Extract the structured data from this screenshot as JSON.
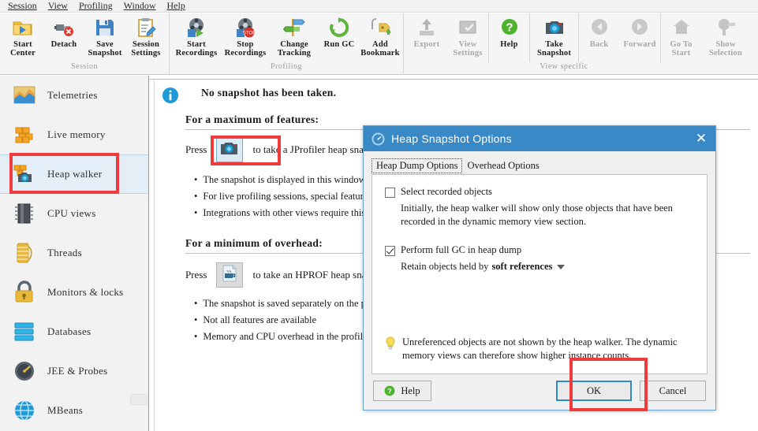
{
  "menubar": {
    "items": [
      "Session",
      "View",
      "Profiling",
      "Window",
      "Help"
    ]
  },
  "toolbar": {
    "groups": [
      {
        "label": "Session",
        "buttons": [
          {
            "label": "Start\nCenter",
            "icon": "start-center-icon",
            "disabled": false
          },
          {
            "label": "Detach",
            "icon": "detach-icon",
            "disabled": false
          },
          {
            "label": "Save\nSnapshot",
            "icon": "save-snapshot-icon",
            "disabled": false
          },
          {
            "label": "Session\nSettings",
            "icon": "session-settings-icon",
            "disabled": false
          }
        ]
      },
      {
        "label": "Profiling",
        "buttons": [
          {
            "label": "Start\nRecordings",
            "icon": "start-recordings-icon",
            "disabled": false
          },
          {
            "label": "Stop\nRecordings",
            "icon": "stop-recordings-icon",
            "disabled": false
          },
          {
            "label": "Change\nTracking",
            "icon": "change-tracking-icon",
            "disabled": false
          },
          {
            "label": "Run GC",
            "icon": "run-gc-icon",
            "disabled": false
          },
          {
            "label": "Add\nBookmark",
            "icon": "add-bookmark-icon",
            "disabled": false
          }
        ]
      },
      {
        "label": "View specific",
        "buttons": [
          {
            "label": "Export",
            "icon": "export-icon",
            "disabled": true
          },
          {
            "label": "View\nSettings",
            "icon": "view-settings-icon",
            "disabled": true
          },
          {
            "label": "Help",
            "icon": "help-icon",
            "disabled": false
          },
          {
            "label": "Take\nSnapshot",
            "icon": "take-snapshot-icon",
            "disabled": false
          },
          {
            "label": "Back",
            "icon": "back-arrow-icon",
            "disabled": true
          },
          {
            "label": "Forward",
            "icon": "forward-arrow-icon",
            "disabled": true
          },
          {
            "label": "Go To\nStart",
            "icon": "go-to-start-icon",
            "disabled": true
          },
          {
            "label": "Show\nSelection",
            "icon": "show-selection-icon",
            "disabled": true
          }
        ]
      }
    ]
  },
  "sidebar": {
    "items": [
      {
        "label": "Telemetries",
        "icon": "telemetries-icon",
        "selected": false
      },
      {
        "label": "Live memory",
        "icon": "live-memory-icon",
        "selected": false
      },
      {
        "label": "Heap walker",
        "icon": "heap-walker-icon",
        "selected": true
      },
      {
        "label": "CPU views",
        "icon": "cpu-views-icon",
        "selected": false
      },
      {
        "label": "Threads",
        "icon": "threads-icon",
        "selected": false
      },
      {
        "label": "Monitors & locks",
        "icon": "monitors-locks-icon",
        "selected": false
      },
      {
        "label": "Databases",
        "icon": "databases-icon",
        "selected": false
      },
      {
        "label": "JEE & Probes",
        "icon": "jee-probes-icon",
        "selected": false
      },
      {
        "label": "MBeans",
        "icon": "mbeans-icon",
        "selected": false
      }
    ]
  },
  "content": {
    "info_icon": "info-icon",
    "title": "No snapshot has been taken.",
    "section_max": {
      "heading": "For a maximum of features:",
      "press_prefix": "Press",
      "press_suffix": "to take a JProfiler heap snapshot",
      "button_icon": "camera-icon",
      "bullets": [
        "The snapshot is displayed in this window",
        "For live profiling sessions, special features are available",
        "Integrations with other views require this snapshot type"
      ]
    },
    "section_min": {
      "heading": "For a minimum of overhead:",
      "press_prefix": "Press",
      "press_suffix": "to take an HPROF heap snapshot",
      "button_icon": "hprof-icon",
      "bullets": [
        "The snapshot is saved separately on the profiled machine",
        "Not all features are available",
        "Memory and CPU overhead in the profiled JVM are lower"
      ]
    }
  },
  "dialog": {
    "title": "Heap Snapshot Options",
    "title_icon": "jprofiler-icon",
    "close_icon": "close-icon",
    "tabs": [
      {
        "label": "Heap Dump Options",
        "active": true
      },
      {
        "label": "Overhead Options",
        "active": false
      }
    ],
    "options": [
      {
        "label": "Select recorded objects",
        "checked": false,
        "description": "Initially, the heap walker will show only those objects that have been recorded in the dynamic memory view section."
      },
      {
        "label": "Perform full GC in heap dump",
        "checked": true,
        "description": ""
      }
    ],
    "retain": {
      "prefix": "Retain objects held by",
      "value": "soft references",
      "caret_icon": "chevron-down-icon"
    },
    "tip": {
      "icon": "lightbulb-icon",
      "text": "Unreferenced objects are not shown by the heap walker. The dynamic memory views can therefore show higher instance counts."
    },
    "buttons": {
      "help": "Help",
      "help_icon": "help-circle-icon",
      "ok": "OK",
      "cancel": "Cancel"
    }
  },
  "colors": {
    "accent": "#3889c5",
    "annotation": "#ef3b3b",
    "selection": "#e4eef6",
    "toolbar_bg": "#f5f5f5",
    "sidebar_bg": "#f2f2f2"
  }
}
